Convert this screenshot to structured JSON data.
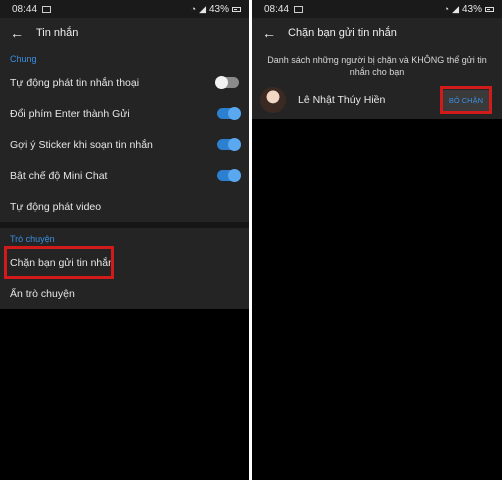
{
  "left": {
    "statusbar": {
      "time": "08:44",
      "battery": "43%"
    },
    "appbar": {
      "title": "Tin nhắn"
    },
    "sections": [
      {
        "header": "Chung",
        "rows": [
          {
            "label": "Tự động phát tin nhắn thoại",
            "toggle": "off"
          },
          {
            "label": "Đổi phím Enter thành Gửi",
            "toggle": "on"
          },
          {
            "label": "Gợi ý Sticker khi soạn tin nhắn",
            "toggle": "on"
          },
          {
            "label": "Bật chế độ Mini Chat",
            "toggle": "on"
          },
          {
            "label": "Tự động phát video"
          }
        ]
      },
      {
        "header": "Trò chuyện",
        "rows": [
          {
            "label": "Chặn bạn gửi tin nhắn"
          },
          {
            "label": "Ẩn trò chuyện"
          }
        ]
      }
    ]
  },
  "right": {
    "statusbar": {
      "time": "08:44",
      "battery": "43%"
    },
    "appbar": {
      "title": "Chặn bạn gửi tin nhắn"
    },
    "description": "Danh sách những người bị chặn và KHÔNG thể gửi tin nhắn cho bạn",
    "contact": {
      "name": "Lê Nhật Thúy Hiền",
      "action": "BỎ CHẶN"
    }
  },
  "colors": {
    "accent": "#3b8fe0",
    "highlight": "#d11a1a",
    "panel": "#242424",
    "background": "#000000"
  }
}
